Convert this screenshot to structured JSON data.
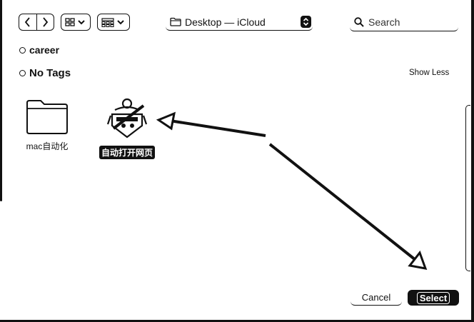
{
  "window": {
    "location": "Desktop — iCloud",
    "search_placeholder": "Search"
  },
  "toolbar": {
    "back_label": "‹",
    "forward_label": "›"
  },
  "tags": [
    {
      "label": "career"
    },
    {
      "label": "No Tags"
    }
  ],
  "show_less_label": "Show Less",
  "items": [
    {
      "name": "mac自动化",
      "kind": "folder",
      "selected": false
    },
    {
      "name": "自动打开网页",
      "kind": "app",
      "selected": true
    }
  ],
  "buttons": {
    "cancel_label": "Cancel",
    "select_label": "Select"
  }
}
